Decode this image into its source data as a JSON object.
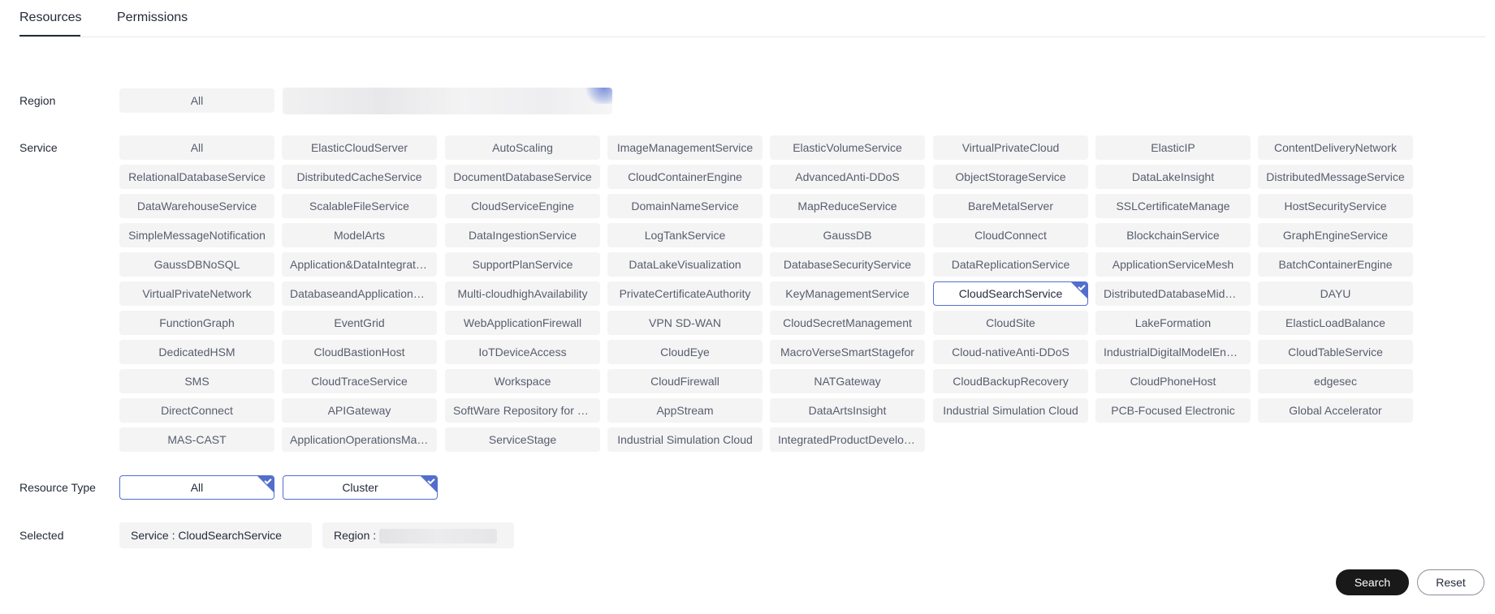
{
  "tabs": [
    {
      "label": "Resources",
      "active": true
    },
    {
      "label": "Permissions",
      "active": false
    }
  ],
  "labels": {
    "region": "Region",
    "service": "Service",
    "resource_type": "Resource Type",
    "selected": "Selected"
  },
  "region": {
    "options": [
      "All"
    ]
  },
  "services": [
    "All",
    "ElasticCloudServer",
    "AutoScaling",
    "ImageManagementService",
    "ElasticVolumeService",
    "VirtualPrivateCloud",
    "ElasticIP",
    "ContentDeliveryNetwork",
    "RelationalDatabaseService",
    "DistributedCacheService",
    "DocumentDatabaseService",
    "CloudContainerEngine",
    "AdvancedAnti-DDoS",
    "ObjectStorageService",
    "DataLakeInsight",
    "DistributedMessageService",
    "DataWarehouseService",
    "ScalableFileService",
    "CloudServiceEngine",
    "DomainNameService",
    "MapReduceService",
    "BareMetalServer",
    "SSLCertificateManage",
    "HostSecurityService",
    "SimpleMessageNotification",
    "ModelArts",
    "DataIngestionService",
    "LogTankService",
    "GaussDB",
    "CloudConnect",
    "BlockchainService",
    "GraphEngineService",
    "GaussDBNoSQL",
    "Application&DataIntegration",
    "SupportPlanService",
    "DataLakeVisualization",
    "DatabaseSecurityService",
    "DataReplicationService",
    "ApplicationServiceMesh",
    "BatchContainerEngine",
    "VirtualPrivateNetwork",
    "DatabaseandApplicationMigration",
    "Multi-cloudhighAvailability",
    "PrivateCertificateAuthority",
    "KeyManagementService",
    "CloudSearchService",
    "DistributedDatabaseMiddleware",
    "DAYU",
    "FunctionGraph",
    "EventGrid",
    "WebApplicationFirewall",
    "VPN SD-WAN",
    "CloudSecretManagement",
    "CloudSite",
    "LakeFormation",
    "ElasticLoadBalance",
    "DedicatedHSM",
    "CloudBastionHost",
    "IoTDeviceAccess",
    "CloudEye",
    "MacroVerseSmartStagefor",
    "Cloud-nativeAnti-DDoS",
    "IndustrialDigitalModelEngine",
    "CloudTableService",
    "SMS",
    "CloudTraceService",
    "Workspace",
    "CloudFirewall",
    "NATGateway",
    "CloudBackupRecovery",
    "CloudPhoneHost",
    "edgesec",
    "DirectConnect",
    "APIGateway",
    "SoftWare Repository for Container",
    "AppStream",
    "DataArtsInsight",
    "Industrial Simulation Cloud",
    "PCB-Focused Electronic",
    "Global Accelerator",
    "MAS-CAST",
    "ApplicationOperationsManagement",
    "ServiceStage",
    "Industrial Simulation Cloud",
    "IntegratedProductDevelopment"
  ],
  "selected_service": "CloudSearchService",
  "resource_types": [
    "All",
    "Cluster"
  ],
  "selected_tags": {
    "service": "Service : CloudSearchService",
    "region": "Region :"
  },
  "buttons": {
    "search": "Search",
    "reset": "Reset"
  },
  "colors": {
    "accent": "#526ecc",
    "primary_button": "#191919",
    "chip_bg": "#f4f4f5"
  }
}
